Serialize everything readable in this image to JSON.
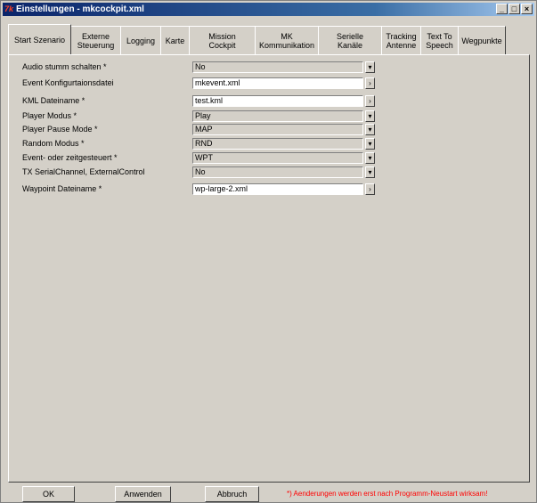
{
  "window": {
    "title": "Einstellungen - mkcockpit.xml",
    "app_icon": "7k",
    "controls": {
      "minimize": "_",
      "maximize": "□",
      "close": "×"
    }
  },
  "tabs": [
    {
      "label": "Start Szenario",
      "active": true
    },
    {
      "label": "Externe\nSteuerung"
    },
    {
      "label": "Logging"
    },
    {
      "label": "Karte"
    },
    {
      "label": "Mission Cockpit"
    },
    {
      "label": "MK\nKommunikation"
    },
    {
      "label": "Serielle Kanäle"
    },
    {
      "label": "Tracking\nAntenne"
    },
    {
      "label": "Text To\nSpeech"
    },
    {
      "label": "Wegpunkte"
    }
  ],
  "settings": [
    {
      "label": "Audio stumm schalten *",
      "value": "No",
      "control": "dropdown"
    },
    {
      "label": "Event Konfigurtaionsdatei",
      "value": "mkevent.xml",
      "control": "file"
    },
    {
      "label": "KML Dateiname *",
      "value": "test.kml",
      "control": "file"
    },
    {
      "label": "Player Modus *",
      "value": "Play",
      "control": "dropdown"
    },
    {
      "label": "Player Pause Mode *",
      "value": "MAP",
      "control": "dropdown"
    },
    {
      "label": "Random Modus *",
      "value": "RND",
      "control": "dropdown"
    },
    {
      "label": "Event- oder zeitgesteuert *",
      "value": "WPT",
      "control": "dropdown"
    },
    {
      "label": "TX SerialChannel, ExternalControl",
      "value": "No",
      "control": "dropdown"
    },
    {
      "label": "Waypoint Dateiname *",
      "value": "wp-large-2.xml",
      "control": "file"
    }
  ],
  "icons": {
    "dropdown": "▾",
    "browse": "›"
  },
  "buttons": {
    "ok": "OK",
    "apply": "Anwenden",
    "cancel": "Abbruch"
  },
  "note": "*) Aenderungen werden erst nach Programm-Neustart wirksam!"
}
